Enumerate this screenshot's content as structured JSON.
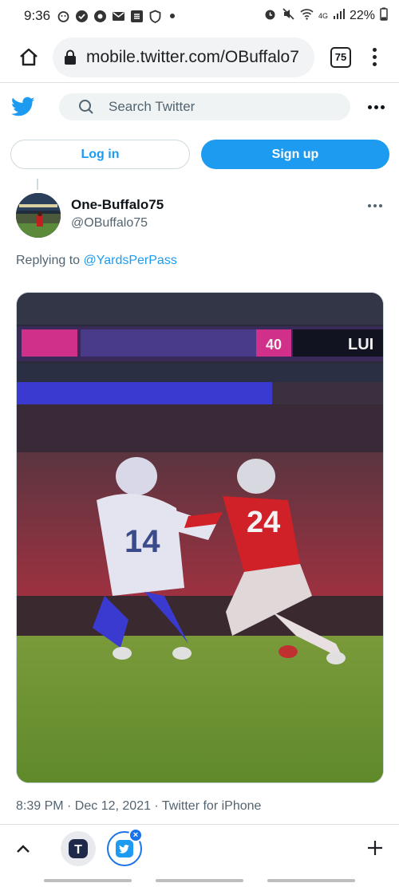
{
  "status_bar": {
    "time": "9:36",
    "network": "4G",
    "battery": "22%"
  },
  "browser": {
    "url": "mobile.twitter.com/OBuffalo7",
    "tab_count": "75"
  },
  "twitter": {
    "search_placeholder": "Search Twitter",
    "login_label": "Log in",
    "signup_label": "Sign up",
    "accent_color": "#1d9bf0"
  },
  "tweet": {
    "display_name": "One-Buffalo75",
    "handle": "@OBuffalo75",
    "replying_prefix": "Replying to",
    "replying_to": "@YardsPerPass",
    "timestamp": "8:39 PM · Dec 12, 2021 · Twitter for iPhone",
    "media": {
      "type": "photo",
      "scoreboard_text": "LUI",
      "scoreboard_number": "40",
      "jersey_left": "14",
      "jersey_right": "24"
    }
  },
  "bottom_bar": {
    "tab1_label": "T",
    "close_badge": "×"
  }
}
